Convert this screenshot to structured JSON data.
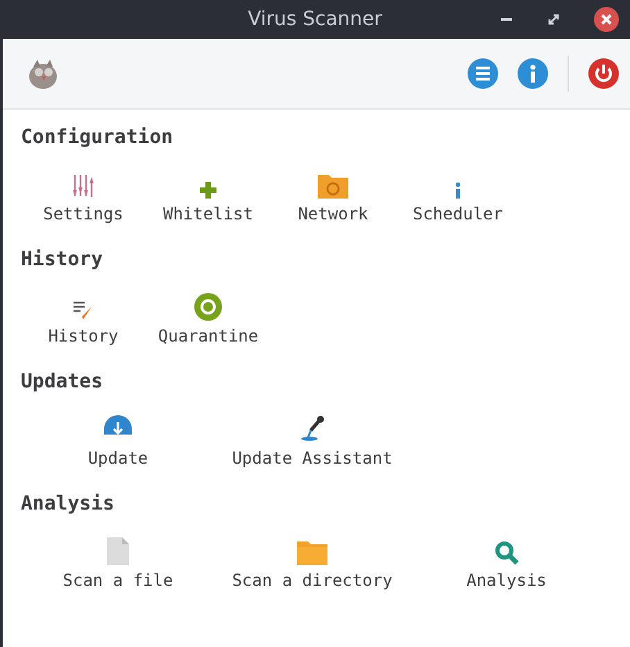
{
  "window": {
    "title": "Virus Scanner"
  },
  "sections": [
    {
      "title": "Configuration",
      "items": [
        "Settings",
        "Whitelist",
        "Network",
        "Scheduler"
      ]
    },
    {
      "title": "History",
      "items": [
        "History",
        "Quarantine"
      ]
    },
    {
      "title": "Updates",
      "items": [
        "Update",
        "Update Assistant"
      ]
    },
    {
      "title": "Analysis",
      "items": [
        "Scan a file",
        "Scan a directory",
        "Analysis"
      ]
    }
  ]
}
